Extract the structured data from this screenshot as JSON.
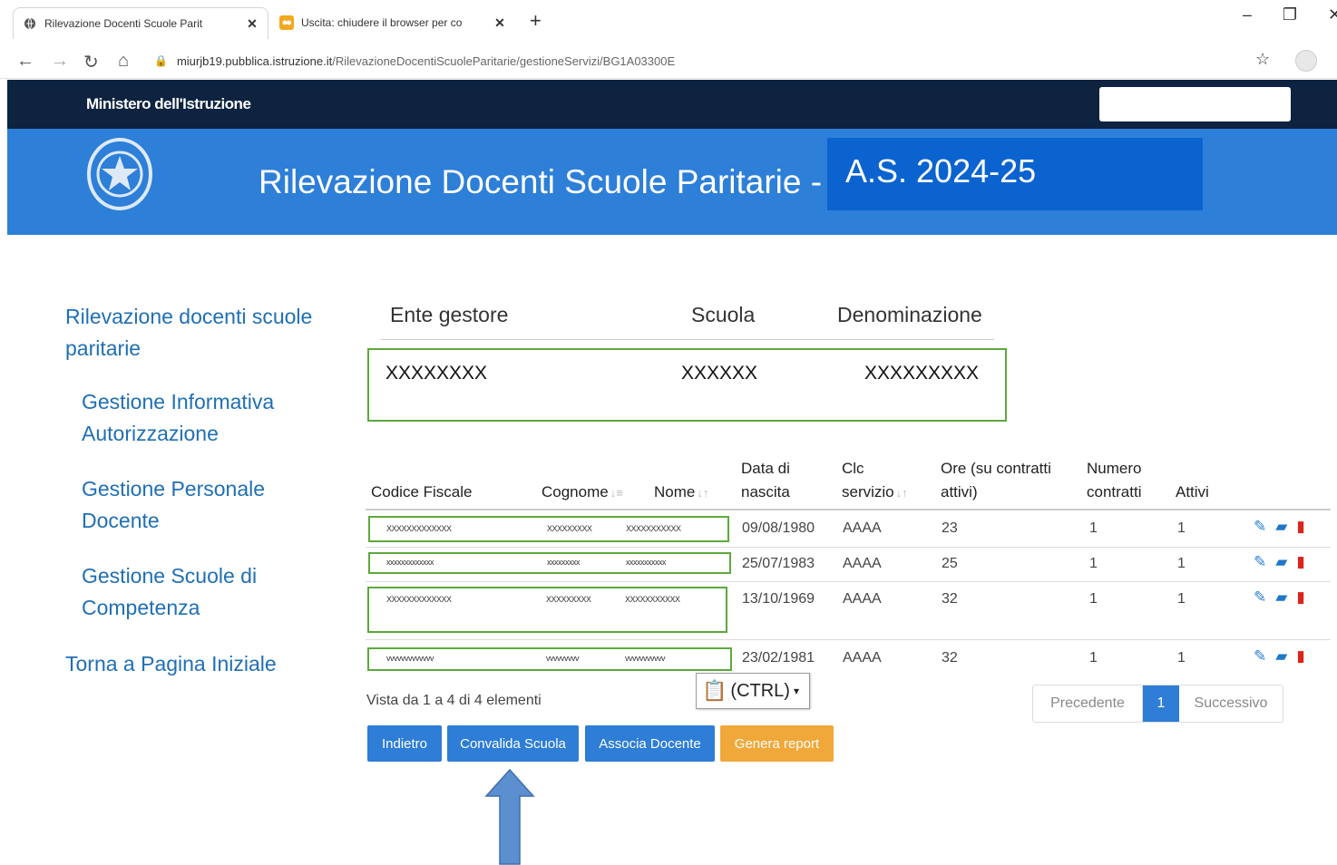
{
  "browser": {
    "tabs": [
      {
        "title": "Rilevazione Docenti Scuole Parit"
      },
      {
        "title": "Uscita: chiudere il browser per co"
      }
    ],
    "url_host": "miurjb19.pubblica.istruzione.it",
    "url_path": "/RilevazioneDocentiScuoleParitarie/gestioneServizi/BG1A03300E"
  },
  "header": {
    "ministry": "Ministero dell'Istruzione",
    "app_title": "Rilevazione Docenti Scuole Paritarie -",
    "school_year": "A.S. 2024-25"
  },
  "sidebar": {
    "items": [
      {
        "label_line1": "Rilevazione docenti scuole",
        "label_line2": "paritarie"
      },
      {
        "label_line1": "Gestione Informativa",
        "label_line2": "Autorizzazione"
      },
      {
        "label_line1": "Gestione Personale",
        "label_line2": "Docente"
      },
      {
        "label_line1": "Gestione Scuole di",
        "label_line2": "Competenza"
      },
      {
        "label_line1": "Torna a Pagina Iniziale"
      }
    ]
  },
  "summary": {
    "headers": [
      "Ente gestore",
      "Scuola",
      "Denominazione"
    ],
    "values": [
      "XXXXXXXX",
      "XXXXXX",
      "XXXXXXXXX"
    ]
  },
  "table": {
    "columns": [
      {
        "line1": "",
        "line2": "Codice Fiscale"
      },
      {
        "line1": "",
        "line2": "Cognome"
      },
      {
        "line1": "",
        "line2": "Nome"
      },
      {
        "line1": "Data di",
        "line2": "nascita"
      },
      {
        "line1": "Clc",
        "line2": "servizio"
      },
      {
        "line1": "Ore (su contratti",
        "line2": "attivi)"
      },
      {
        "line1": "Numero",
        "line2": "contratti"
      },
      {
        "line1": "",
        "line2": "Attivi"
      }
    ],
    "rows": [
      {
        "cf": "XXXXXXXXXXXXX",
        "cognome": "XXXXXXXXX",
        "nome": "XXXXXXXXXXX",
        "data": "09/08/1980",
        "clc": "AAAA",
        "ore": "23",
        "numero": "1",
        "attivi": "1"
      },
      {
        "cf": "xxxxxxxxxxxxx",
        "cognome": "xxxxxxxxx",
        "nome": "xxxxxxxxxxx",
        "data": "25/07/1983",
        "clc": "AAAA",
        "ore": "25",
        "numero": "1",
        "attivi": "1"
      },
      {
        "cf": "XXXXXXXXXXXXX",
        "cognome": "XXXXXXXXX",
        "nome": "XXXXXXXXXXX",
        "data": "13/10/1969",
        "clc": "AAAA",
        "ore": "32",
        "numero": "1",
        "attivi": "1"
      },
      {
        "cf": "vvvvvvvvvvvvv",
        "cognome": "vvvvvvvvv",
        "nome": "vvvvvvvvvvv",
        "data": "23/02/1981",
        "clc": "AAAA",
        "ore": "32",
        "numero": "1",
        "attivi": "1"
      }
    ],
    "row_icons": [
      "edit-icon",
      "folder-open-icon",
      "trash-icon"
    ]
  },
  "footer": {
    "info": "Vista da 1 a 4 di 4 elementi",
    "paste_label": "(CTRL)",
    "pagination": {
      "prev": "Precedente",
      "current": "1",
      "next": "Successivo"
    },
    "buttons": {
      "back": "Indietro",
      "validate": "Convalida Scuola",
      "associate": "Associa Docente",
      "report": "Genera report"
    }
  },
  "colors": {
    "navy": "#0d2340",
    "banner_blue": "#2d7fd8",
    "school_year_box": "#0a63cf",
    "link_blue": "#1f6fb5",
    "button_blue": "#2e7dd6",
    "button_orange": "#f0a83a",
    "highlight_green": "#5ea83d",
    "arrow_blue": "#5b8fd0"
  }
}
